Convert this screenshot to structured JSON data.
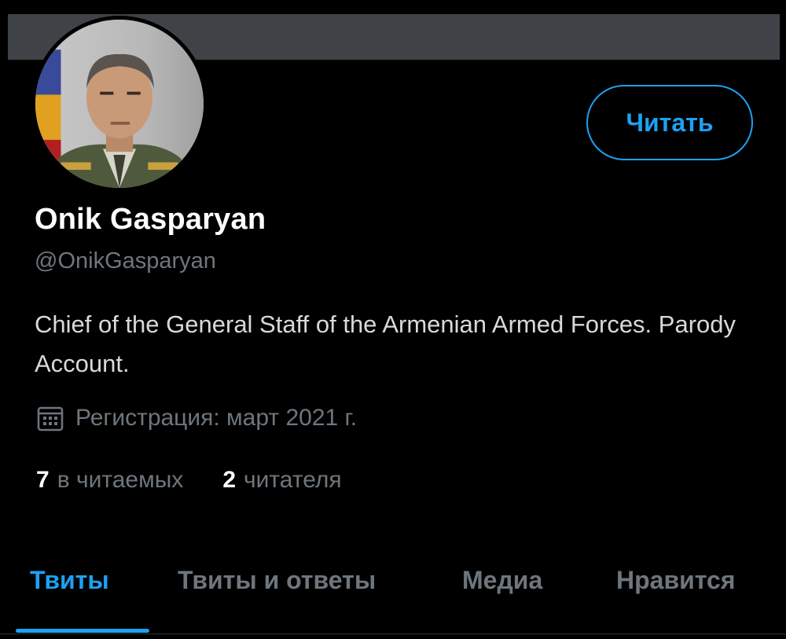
{
  "profile": {
    "display_name": "Onik Gasparyan",
    "handle": "@OnikGasparyan",
    "bio": "Chief of the General Staff of the Armenian Armed Forces. Parody Account.",
    "joined": "Регистрация: март 2021 г.",
    "follow_label": "Читать"
  },
  "stats": {
    "following_count": "7",
    "following_label": "в читаемых",
    "followers_count": "2",
    "followers_label": "читателя"
  },
  "tabs": [
    {
      "label": "Твиты",
      "active": true
    },
    {
      "label": "Твиты и ответы",
      "active": false
    },
    {
      "label": "Медиа",
      "active": false
    },
    {
      "label": "Нравится",
      "active": false
    }
  ],
  "colors": {
    "background": "#000000",
    "accent": "#1da1f2",
    "muted_text": "#6e767d",
    "banner": "#3f4347"
  },
  "icons": {
    "joined": "calendar-icon"
  }
}
